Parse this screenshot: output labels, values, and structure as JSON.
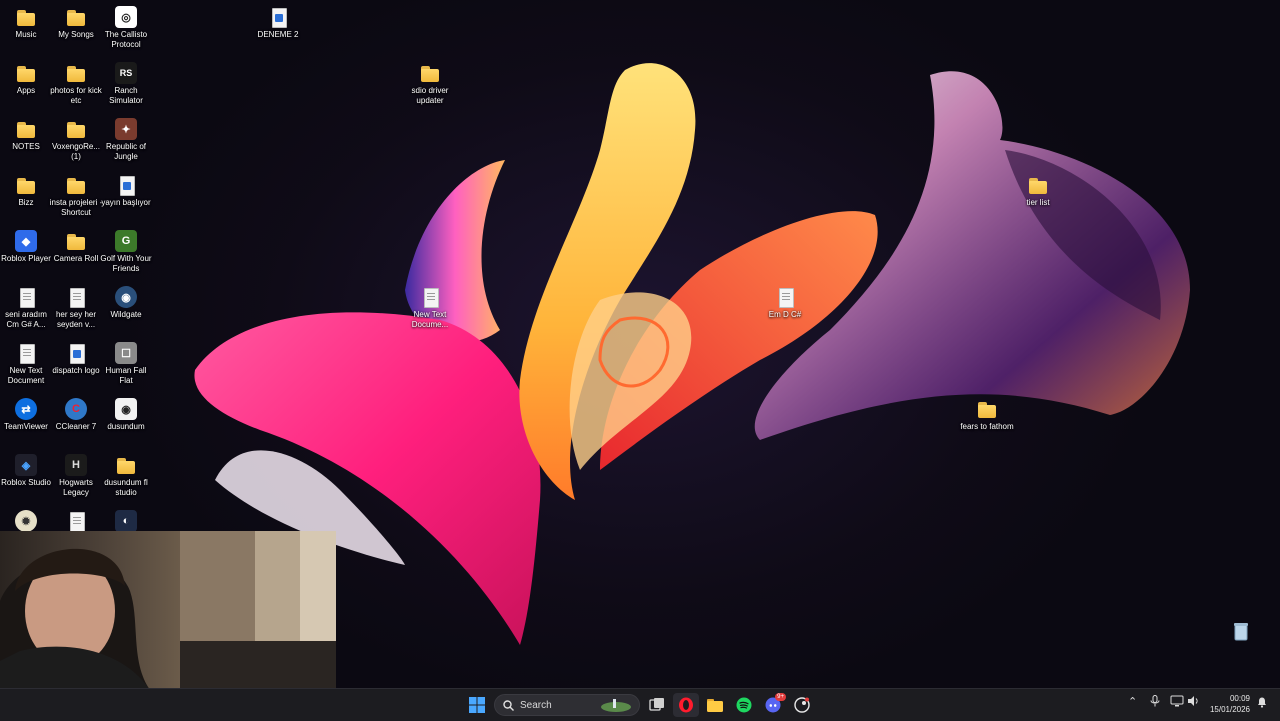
{
  "desktop_icons": [
    {
      "label": "Music",
      "kind": "folder"
    },
    {
      "label": "My Songs",
      "kind": "folder"
    },
    {
      "label": "The Callisto Protocol",
      "kind": "app",
      "icon": "callisto-icon",
      "color": "#ffffff",
      "symbol": "◎"
    },
    {
      "label": "DENEME 2",
      "kind": "docblue"
    },
    {
      "label": "Apps",
      "kind": "folder"
    },
    {
      "label": "photos for kick etc",
      "kind": "folder"
    },
    {
      "label": "Ranch Simulator",
      "kind": "app",
      "icon": "ranch-simulator-icon",
      "color": "#1a1a1a",
      "symbol": "RS"
    },
    {
      "label": "sdio driver updater",
      "kind": "folder"
    },
    {
      "label": "NOTES",
      "kind": "folder"
    },
    {
      "label": "VoxengoRe... (1)",
      "kind": "folder"
    },
    {
      "label": "Republic of Jungle",
      "kind": "app",
      "icon": "republic-of-jungle-icon",
      "color": "#7a3b2e",
      "symbol": "✦"
    },
    {
      "label": "tier list",
      "kind": "folder"
    },
    {
      "label": "Bizz",
      "kind": "folder"
    },
    {
      "label": "insta projeleri - Shortcut",
      "kind": "folder"
    },
    {
      "label": "yayın başlıyor",
      "kind": "docblue"
    },
    {
      "label": "Roblox Player",
      "kind": "app",
      "icon": "roblox-player-icon",
      "color": "#2f6bea",
      "symbol": "◆"
    },
    {
      "label": "Camera Roll",
      "kind": "folder"
    },
    {
      "label": "Golf With Your Friends",
      "kind": "app",
      "icon": "golf-with-your-friends-icon",
      "color": "#3c7a2a",
      "symbol": "G"
    },
    {
      "label": "seni aradım Cm G# A...",
      "kind": "doc"
    },
    {
      "label": "her sey her seyden v...",
      "kind": "doc"
    },
    {
      "label": "Wildgate",
      "kind": "app",
      "icon": "wildgate-icon",
      "color": "#2a4f7a",
      "symbol": "◉"
    },
    {
      "label": "New Text Docume...",
      "kind": "doc"
    },
    {
      "label": "Em D C#",
      "kind": "doc"
    },
    {
      "label": "New Text Document",
      "kind": "doc"
    },
    {
      "label": "dispatch logo",
      "kind": "docblue"
    },
    {
      "label": "Human Fall Flat",
      "kind": "app",
      "icon": "human-fall-flat-icon",
      "color": "#8a8a8a",
      "symbol": "☐"
    },
    {
      "label": "TeamViewer",
      "kind": "app",
      "icon": "teamviewer-icon",
      "color": "#0e6fe0",
      "symbol": "⇄"
    },
    {
      "label": "CCleaner 7",
      "kind": "app",
      "icon": "ccleaner-icon",
      "color": "#2f78c8",
      "symbol": "C"
    },
    {
      "label": "dusundum",
      "kind": "app",
      "icon": "dusundum-icon",
      "color": "#f2f2f2",
      "symbol": "◉"
    },
    {
      "label": "fears to fathom",
      "kind": "folder"
    },
    {
      "label": "Roblox Studio",
      "kind": "app",
      "icon": "roblox-studio-icon",
      "color": "#1f1f2b",
      "symbol": "◈"
    },
    {
      "label": "Hogwarts Legacy",
      "kind": "app",
      "icon": "hogwarts-legacy-icon",
      "color": "#1b1b1b",
      "symbol": "H"
    },
    {
      "label": "dusundum fl studio",
      "kind": "folder"
    }
  ],
  "taskbar": {
    "search_label": "Search",
    "apps": [
      "start-icon",
      "task-view-icon",
      "opera-icon",
      "file-explorer-icon",
      "spotify-icon",
      "discord-icon",
      "steam-icon"
    ],
    "discord_badge": "9+",
    "time": "00:09",
    "date": "15/01/2026"
  },
  "colors": {
    "taskbar": "#1c1c20",
    "accent": "#2f7bff"
  }
}
